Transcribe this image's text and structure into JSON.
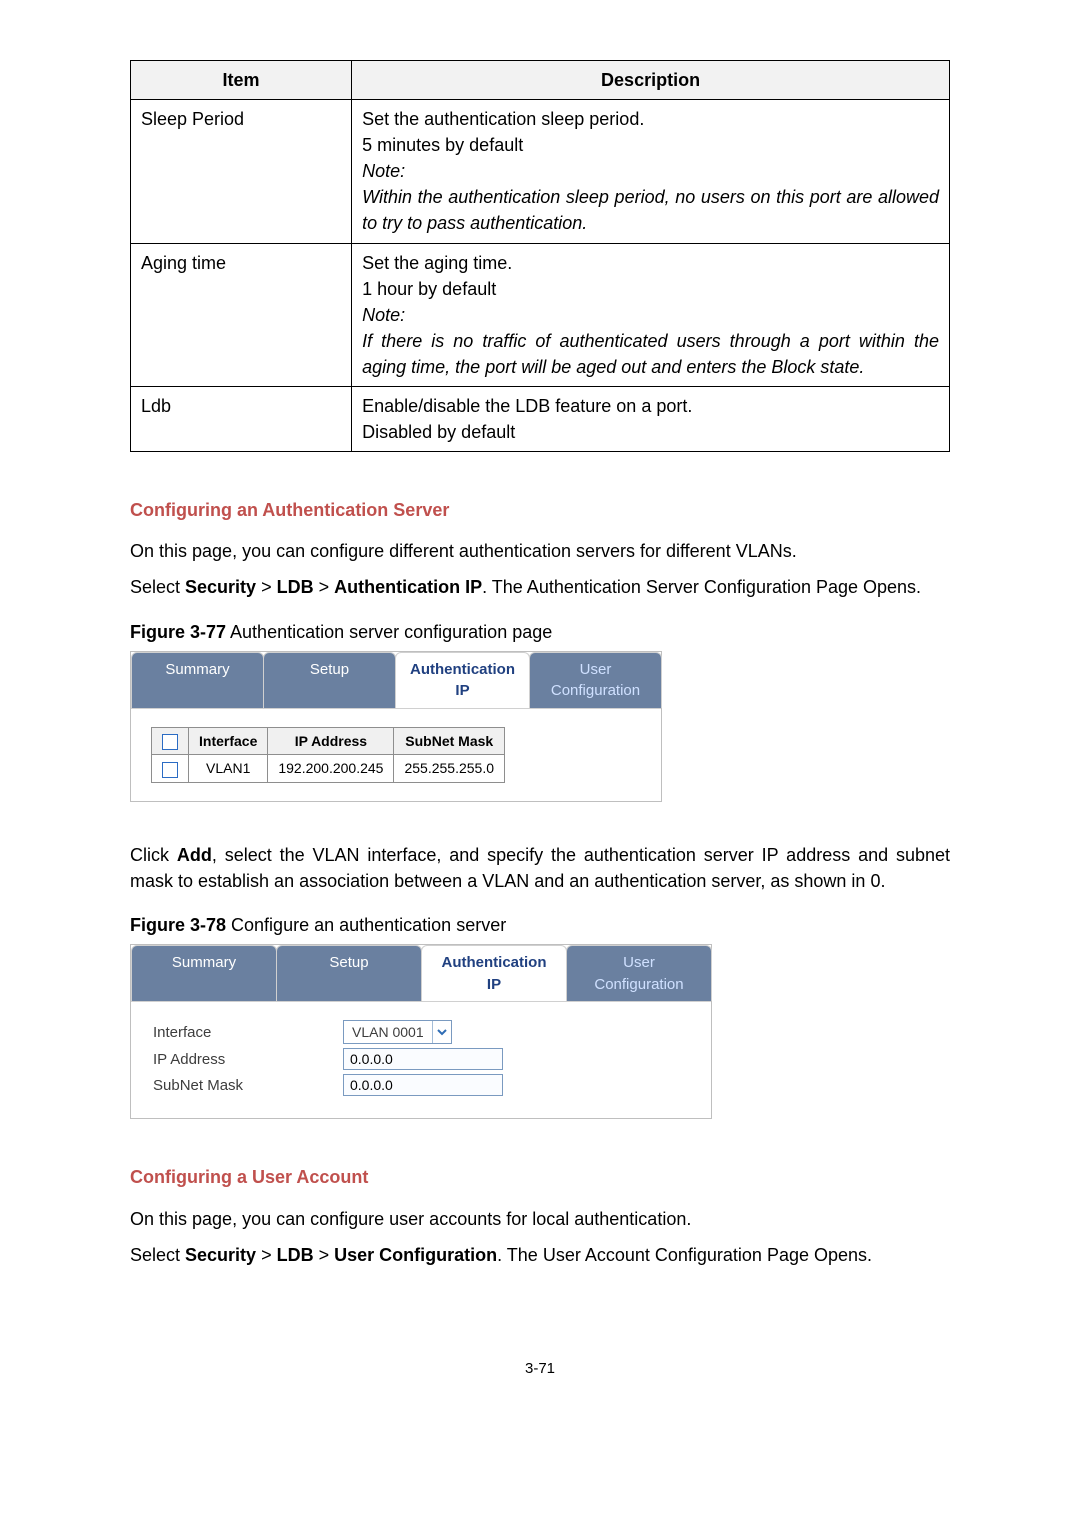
{
  "table": {
    "head_item": "Item",
    "head_desc": "Description",
    "rows": [
      {
        "item": "Sleep Period",
        "lines": [
          {
            "kind": "plain",
            "text": "Set the authentication sleep period."
          },
          {
            "kind": "plain",
            "text": "5 minutes by default"
          },
          {
            "kind": "italic",
            "text": "Note:"
          },
          {
            "kind": "italic-justify",
            "text": "Within the authentication sleep period, no users on this port are allowed to try to pass authentication."
          }
        ]
      },
      {
        "item": "Aging time",
        "lines": [
          {
            "kind": "plain",
            "text": "Set the aging time."
          },
          {
            "kind": "plain",
            "text": "1 hour by default"
          },
          {
            "kind": "italic",
            "text": "Note:"
          },
          {
            "kind": "italic-justify",
            "text": "If there is no traffic of authenticated users through a port within the aging time, the port will be aged out and enters the Block state."
          }
        ]
      },
      {
        "item": "Ldb",
        "lines": [
          {
            "kind": "plain",
            "text": "Enable/disable the LDB feature on a port."
          },
          {
            "kind": "plain",
            "text": "Disabled by default"
          }
        ]
      }
    ]
  },
  "section1": {
    "heading": "Configuring an Authentication Server",
    "intro": "On this page, you can configure different authentication servers for different VLANs.",
    "nav_prefix": "Select ",
    "nav_security": "Security",
    "nav_gt1": " > ",
    "nav_ldb": "LDB",
    "nav_gt2": " > ",
    "nav_auth": "Authentication IP",
    "nav_suffix": ". The Authentication Server Configuration Page Opens.",
    "fig77_no": "Figure 3-77",
    "fig77_caption": " Authentication server configuration page"
  },
  "fig77": {
    "tabs": {
      "summary": "Summary",
      "setup": "Setup",
      "auth": "Authentication IP",
      "user": "User Configuration"
    },
    "th_interface": "Interface",
    "th_ip": "IP Address",
    "th_mask": "SubNet Mask",
    "row1_interface": "VLAN1",
    "row1_ip": "192.200.200.245",
    "row1_mask": "255.255.255.0"
  },
  "section1b": {
    "click_prefix": "Click ",
    "click_b": "Add",
    "click_suffix": ", select the VLAN interface, and specify the authentication server IP address and subnet mask to establish an association between a VLAN and an authentication server, as shown in 0.",
    "fig78_no": "Figure 3-78",
    "fig78_caption": " Configure an authentication server"
  },
  "fig78": {
    "tabs": {
      "summary": "Summary",
      "setup": "Setup",
      "auth": "Authentication IP",
      "user": "User Configuration"
    },
    "lbl_interface": "Interface",
    "lbl_ip": "IP Address",
    "lbl_mask": "SubNet Mask",
    "val_interface": "VLAN 0001",
    "val_ip": "0.0.0.0",
    "val_mask": "0.0.0.0"
  },
  "section2": {
    "heading": "Configuring a User Account",
    "intro": "On this page, you can configure user accounts for local authentication.",
    "nav_prefix": "Select ",
    "nav_security": "Security",
    "nav_gt1": " > ",
    "nav_ldb": "LDB",
    "nav_gt2": " > ",
    "nav_user": "User Configuration",
    "nav_suffix": ". The User Account Configuration Page Opens."
  },
  "page_number": "3-71"
}
